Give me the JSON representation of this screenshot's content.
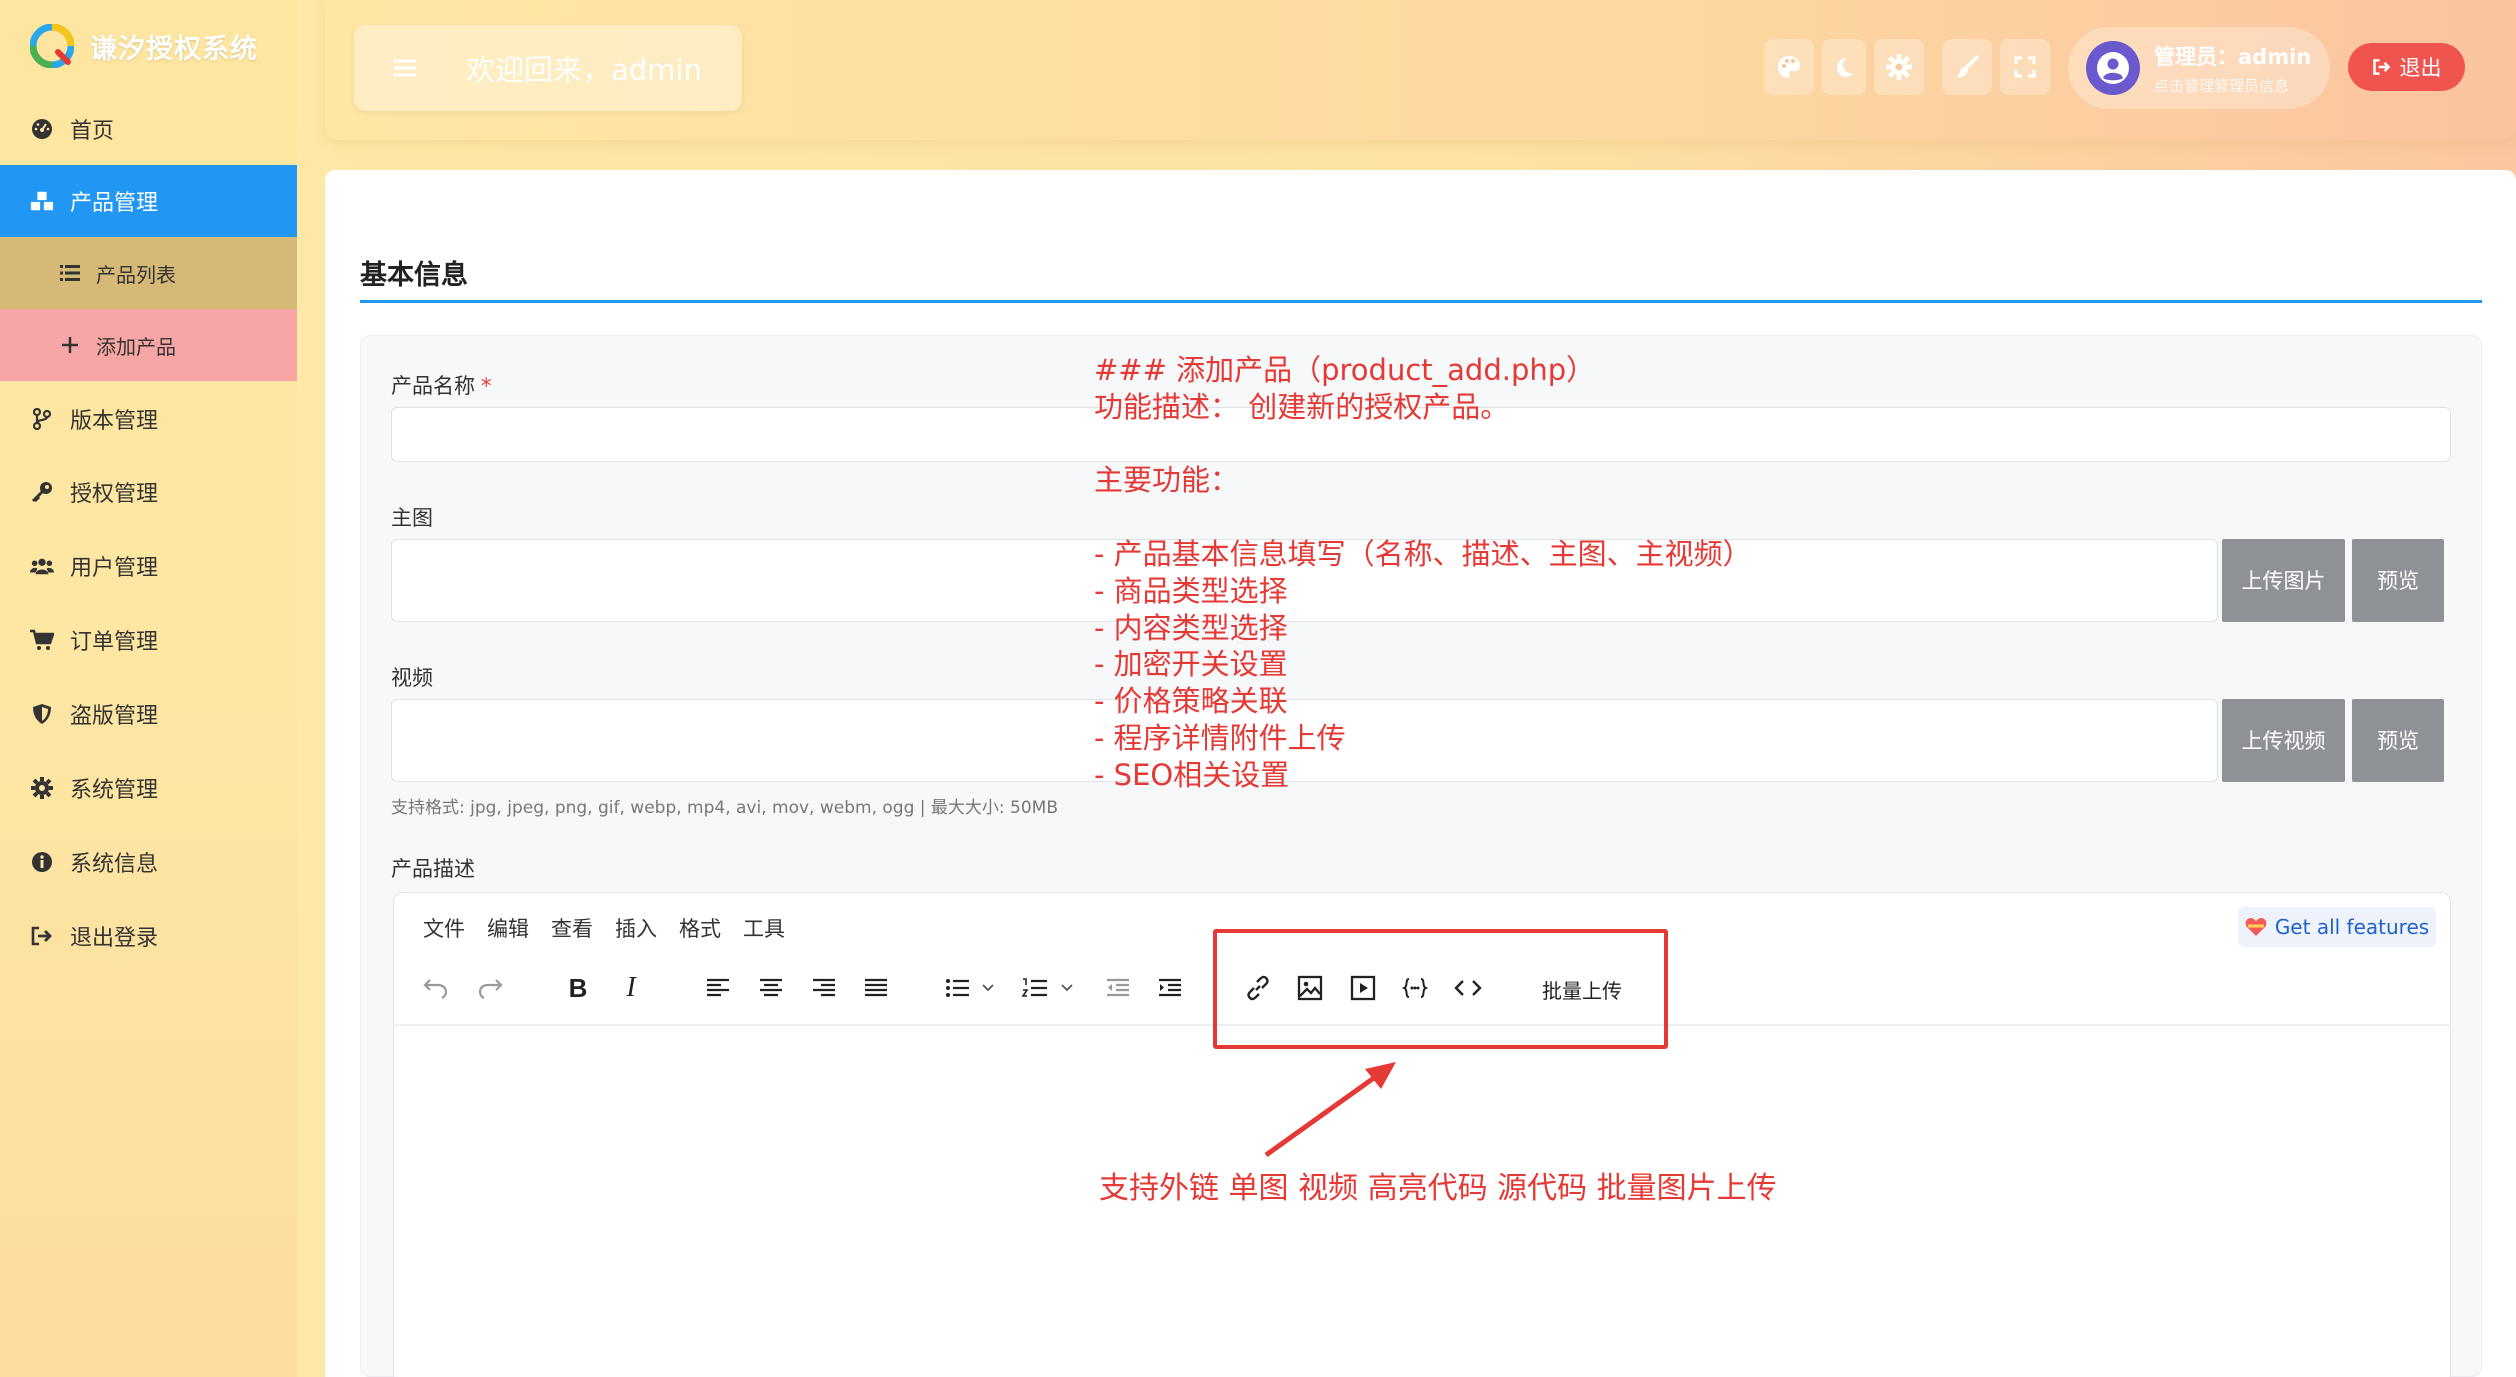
{
  "app": {
    "title": "谦汐授权系统"
  },
  "sidebar": {
    "items": [
      {
        "label": "首页",
        "icon": "dashboard-icon"
      },
      {
        "label": "产品管理",
        "icon": "cubes-icon",
        "active": true
      },
      {
        "label": "产品列表",
        "icon": "list-icon",
        "sub": true
      },
      {
        "label": "添加产品",
        "icon": "plus-icon",
        "sub": true,
        "current": true
      },
      {
        "label": "版本管理",
        "icon": "branch-icon"
      },
      {
        "label": "授权管理",
        "icon": "key-icon"
      },
      {
        "label": "用户管理",
        "icon": "users-icon"
      },
      {
        "label": "订单管理",
        "icon": "cart-icon"
      },
      {
        "label": "盗版管理",
        "icon": "shield-icon"
      },
      {
        "label": "系统管理",
        "icon": "gear-icon"
      },
      {
        "label": "系统信息",
        "icon": "info-icon"
      },
      {
        "label": "退出登录",
        "icon": "sign-out-icon"
      }
    ]
  },
  "header": {
    "welcome": "欢迎回来，admin",
    "user_name": "管理员：admin",
    "user_sub": "点击管理管理员信息",
    "logout": "退出"
  },
  "form": {
    "section_title": "基本信息",
    "name_label": "产品名称",
    "required_mark": "*",
    "image_label": "主图",
    "upload_image": "上传图片",
    "preview": "预览",
    "video_label": "视频",
    "upload_video": "上传视频",
    "format_hint": "支持格式: jpg, jpeg, png, gif, webp, mp4, avi, mov, webm, ogg | 最大大小: 50MB",
    "desc_label": "产品描述"
  },
  "editor": {
    "menu": [
      "文件",
      "编辑",
      "查看",
      "插入",
      "格式",
      "工具"
    ],
    "get_all": "Get all features",
    "batch_upload": "批量上传"
  },
  "annotation": {
    "lines": [
      "### 添加产品（product_add.php）",
      "功能描述： 创建新的授权产品。",
      "",
      "主要功能：",
      "",
      "- 产品基本信息填写（名称、描述、主图、主视频）",
      "- 商品类型选择",
      "- 内容类型选择",
      "- 加密开关设置",
      "- 价格策略关联",
      "- 程序详情附件上传",
      "- SEO相关设置"
    ],
    "callout": "支持外链 单图 视频 高亮代码 源代码 批量图片上传"
  },
  "colors": {
    "accent": "#2196f3",
    "danger": "#e53935",
    "logout": "#f0544f"
  }
}
